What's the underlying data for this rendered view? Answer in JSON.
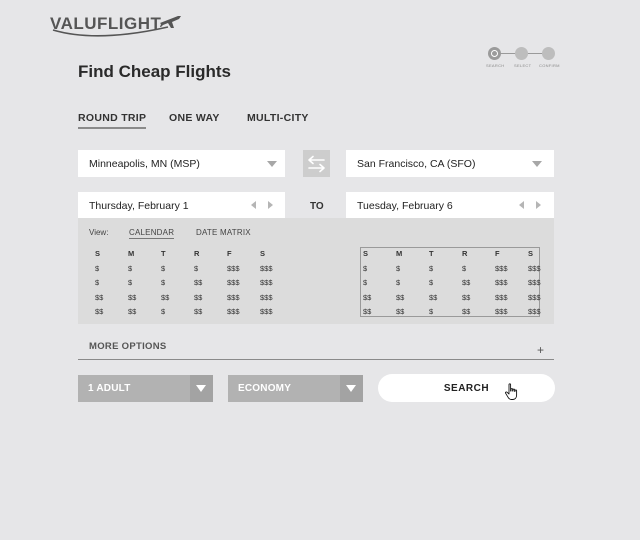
{
  "brand": {
    "logo_text": "VALUFLIGHT"
  },
  "steps": [
    {
      "label": "SEARCH",
      "active": true
    },
    {
      "label": "SELECT",
      "active": false
    },
    {
      "label": "CONFIRM",
      "active": false
    }
  ],
  "page_title": "Find Cheap Flights",
  "trip_tabs": [
    {
      "label": "ROUND TRIP",
      "active": true
    },
    {
      "label": "ONE WAY",
      "active": false
    },
    {
      "label": "MULTI-CITY",
      "active": false
    }
  ],
  "origin": {
    "value": "Minneapolis, MN (MSP)"
  },
  "destination": {
    "value": "San Francisco, CA (SFO)"
  },
  "depart_date": {
    "value": "Thursday, February 1"
  },
  "return_date": {
    "value": "Tuesday, February 6"
  },
  "to_label": "TO",
  "calendar": {
    "view_label": "View:",
    "view_options": [
      {
        "label": "CALENDAR",
        "active": true
      },
      {
        "label": "DATE MATRIX",
        "active": false
      }
    ],
    "day_headers": [
      "S",
      "M",
      "T",
      "R",
      "F",
      "S"
    ],
    "depart_rows": [
      [
        "$",
        "$",
        "$",
        "$",
        "$$$",
        "$$$"
      ],
      [
        "$",
        "$",
        "$",
        "$$",
        "$$$",
        "$$$"
      ],
      [
        "$$",
        "$$",
        "$$",
        "$$",
        "$$$",
        "$$$"
      ],
      [
        "$$",
        "$$",
        "$",
        "$$",
        "$$$",
        "$$$"
      ]
    ],
    "return_rows": [
      [
        "$",
        "$",
        "$",
        "$",
        "$$$",
        "$$$"
      ],
      [
        "$",
        "$",
        "$",
        "$$",
        "$$$",
        "$$$"
      ],
      [
        "$$",
        "$$",
        "$$",
        "$$",
        "$$$",
        "$$$"
      ],
      [
        "$$",
        "$$",
        "$",
        "$$",
        "$$$",
        "$$$"
      ]
    ]
  },
  "more_options": {
    "label": "MORE OPTIONS",
    "icon": "plus-icon"
  },
  "passengers": {
    "value": "1 ADULT"
  },
  "cabin": {
    "value": "ECONOMY"
  },
  "search_button": {
    "label": "SEARCH"
  },
  "colors": {
    "background": "#e6e6e8",
    "select_bg": "#b2b2b2",
    "field_bg": "#ffffff"
  }
}
